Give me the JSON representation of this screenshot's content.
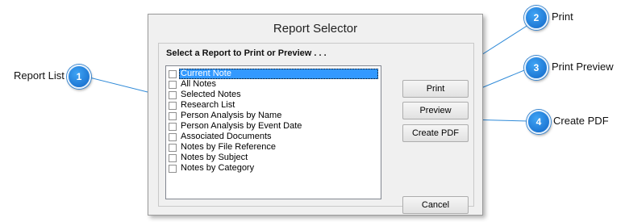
{
  "dialog": {
    "title": "Report Selector",
    "prompt": "Select a Report to Print or Preview . . .",
    "reports": [
      {
        "label": "Current Note",
        "selected": true
      },
      {
        "label": "All Notes",
        "selected": false
      },
      {
        "label": "Selected Notes",
        "selected": false
      },
      {
        "label": "Research List",
        "selected": false
      },
      {
        "label": "Person Analysis by Name",
        "selected": false
      },
      {
        "label": "Person Analysis by Event Date",
        "selected": false
      },
      {
        "label": "Associated Documents",
        "selected": false
      },
      {
        "label": "Notes by File Reference",
        "selected": false
      },
      {
        "label": "Notes by Subject",
        "selected": false
      },
      {
        "label": "Notes by Category",
        "selected": false
      }
    ],
    "buttons": {
      "print": "Print",
      "preview": "Preview",
      "create_pdf": "Create PDF",
      "cancel": "Cancel"
    }
  },
  "callouts": [
    {
      "number": "1",
      "label": "Report List"
    },
    {
      "number": "2",
      "label": "Print"
    },
    {
      "number": "3",
      "label": "Print Preview"
    },
    {
      "number": "4",
      "label": "Create PDF"
    }
  ],
  "colors": {
    "callout_blue": "#1a78d6",
    "selection": "#3399ff"
  }
}
